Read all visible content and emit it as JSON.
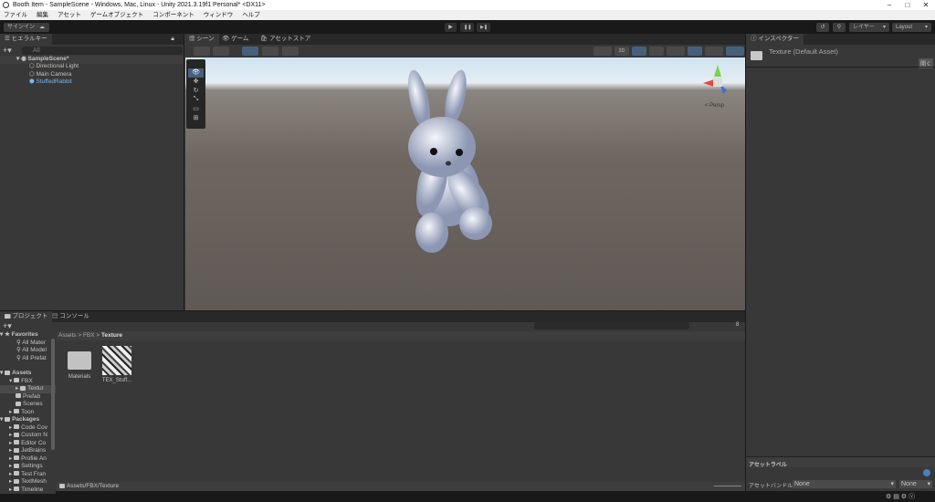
{
  "window": {
    "title": "Booth Item - SampleScene - Windows, Mac, Linux - Unity 2021.3.19f1 Personal* <DX11>",
    "minimize": "–",
    "maximize": "□",
    "close": "✕"
  },
  "menu": [
    "ファイル",
    "編集",
    "アセット",
    "ゲームオブジェクト",
    "コンポーネント",
    "ウィンドウ",
    "ヘルプ"
  ],
  "toolbar": {
    "signin": "サインイン",
    "layers": "レイヤー",
    "layout": "Layout",
    "play": "▶",
    "pause": "❚❚",
    "step": "▶❚"
  },
  "hierarchy": {
    "tab": "ヒエラルキー",
    "search_placeholder": "All",
    "scene": "SampleScene*",
    "items": [
      "Directional Light",
      "Main Camera",
      "StuffedRabbit"
    ]
  },
  "scene_view": {
    "tabs": [
      "シーン",
      "ゲーム",
      "アセットストア"
    ],
    "mode_2d": "2D",
    "persp": "< Persp"
  },
  "inspector": {
    "tab": "インスペクター",
    "title": "Texture (Default Asset)",
    "open_button": "開く",
    "asset_labels": "アセットラベル",
    "asset_bundle_label": "アセットバンドル",
    "bundle_value": "None",
    "variant_value": "None"
  },
  "project": {
    "tabs": [
      "プロジェクト",
      "コンソール"
    ],
    "favorites": {
      "label": "Favorites",
      "items": [
        "All Mater",
        "All Model",
        "All Prefat"
      ]
    },
    "assets": {
      "label": "Assets",
      "items": [
        "FBX",
        "Textur",
        "Prefab",
        "Scenes",
        "Toon"
      ]
    },
    "packages": {
      "label": "Packages",
      "items": [
        "Code Cov",
        "Custom N",
        "Editor Co",
        "JetBrains",
        "Profile An",
        "Settings",
        "Test Fran",
        "TextMesh",
        "Timeline"
      ]
    },
    "breadcrumb": [
      "Assets",
      "FBX",
      "Texture"
    ],
    "files": [
      "Materials",
      "TEX_Stuff..."
    ],
    "path": "Assets/FBX/Texture",
    "count": "8"
  }
}
